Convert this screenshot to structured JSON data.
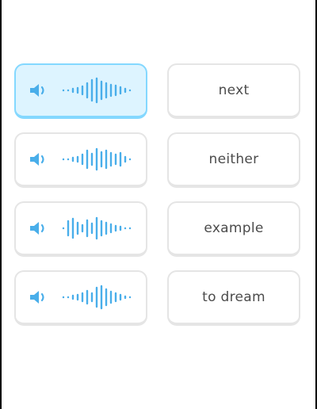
{
  "colors": {
    "accent": "#49aeea",
    "selected_background": "#ddf4ff",
    "selected_border": "#84d8ff",
    "card_border": "#e5e5e5",
    "text": "#4b4b4b"
  },
  "audio_cards": [
    {
      "icon": "speaker-icon",
      "selected": true
    },
    {
      "icon": "speaker-icon",
      "selected": false
    },
    {
      "icon": "speaker-icon",
      "selected": false
    },
    {
      "icon": "speaker-icon",
      "selected": false
    }
  ],
  "word_cards": [
    {
      "label": "next"
    },
    {
      "label": "neither"
    },
    {
      "label": "example"
    },
    {
      "label": "to dream"
    }
  ]
}
